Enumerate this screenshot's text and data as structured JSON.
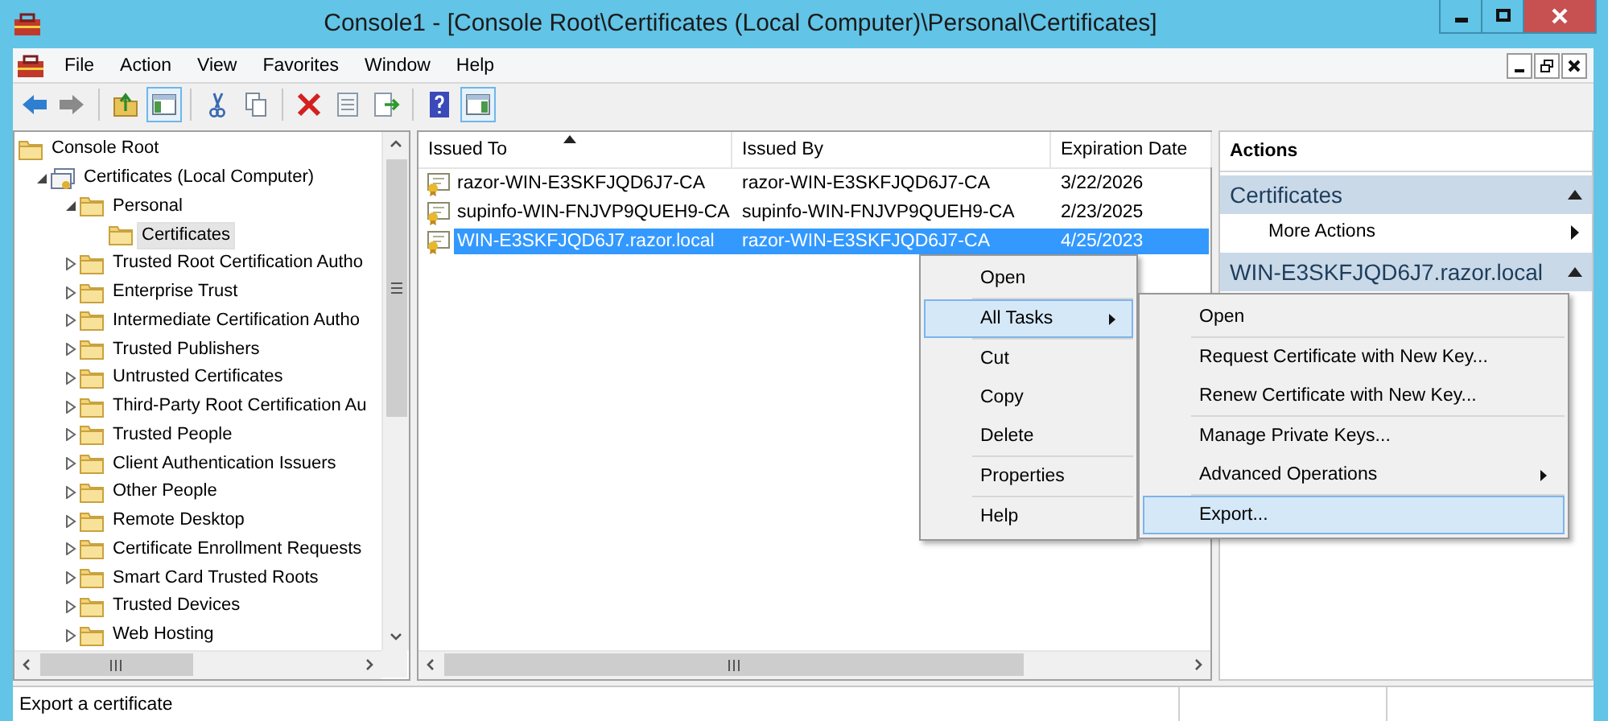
{
  "window": {
    "title": "Console1 - [Console Root\\Certificates (Local Computer)\\Personal\\Certificates]"
  },
  "menu_bar": [
    "File",
    "Action",
    "View",
    "Favorites",
    "Window",
    "Help"
  ],
  "tree": [
    {
      "label": "Console Root",
      "kind": "folder",
      "expandable": false,
      "selected": false,
      "children": [
        {
          "label": "Certificates (Local Computer)",
          "kind": "store",
          "expandable": true,
          "expanded": true,
          "selected": false,
          "children": [
            {
              "label": "Personal",
              "kind": "folder",
              "expandable": true,
              "expanded": true,
              "selected": false,
              "children": [
                {
                  "label": "Certificates",
                  "kind": "folder",
                  "expandable": false,
                  "selected": true
                }
              ]
            },
            {
              "label": "Trusted Root Certification Autho",
              "kind": "folder",
              "expandable": true,
              "expanded": false,
              "selected": false
            },
            {
              "label": "Enterprise Trust",
              "kind": "folder",
              "expandable": true,
              "expanded": false,
              "selected": false
            },
            {
              "label": "Intermediate Certification Autho",
              "kind": "folder",
              "expandable": true,
              "expanded": false,
              "selected": false
            },
            {
              "label": "Trusted Publishers",
              "kind": "folder",
              "expandable": true,
              "expanded": false,
              "selected": false
            },
            {
              "label": "Untrusted Certificates",
              "kind": "folder",
              "expandable": true,
              "expanded": false,
              "selected": false
            },
            {
              "label": "Third-Party Root Certification Au",
              "kind": "folder",
              "expandable": true,
              "expanded": false,
              "selected": false
            },
            {
              "label": "Trusted People",
              "kind": "folder",
              "expandable": true,
              "expanded": false,
              "selected": false
            },
            {
              "label": "Client Authentication Issuers",
              "kind": "folder",
              "expandable": true,
              "expanded": false,
              "selected": false
            },
            {
              "label": "Other People",
              "kind": "folder",
              "expandable": true,
              "expanded": false,
              "selected": false
            },
            {
              "label": "Remote Desktop",
              "kind": "folder",
              "expandable": true,
              "expanded": false,
              "selected": false
            },
            {
              "label": "Certificate Enrollment Requests",
              "kind": "folder",
              "expandable": true,
              "expanded": false,
              "selected": false
            },
            {
              "label": "Smart Card Trusted Roots",
              "kind": "folder",
              "expandable": true,
              "expanded": false,
              "selected": false
            },
            {
              "label": "Trusted Devices",
              "kind": "folder",
              "expandable": true,
              "expanded": false,
              "selected": false
            },
            {
              "label": "Web Hosting",
              "kind": "folder",
              "expandable": true,
              "expanded": false,
              "selected": false
            }
          ]
        }
      ]
    }
  ],
  "table": {
    "columns": [
      {
        "label": "Issued To",
        "sorted": true
      },
      {
        "label": "Issued By",
        "sorted": false
      },
      {
        "label": "Expiration Date",
        "sorted": false
      }
    ],
    "rows": [
      {
        "selected": false,
        "cells": [
          "razor-WIN-E3SKFJQD6J7-CA",
          "razor-WIN-E3SKFJQD6J7-CA",
          "3/22/2026"
        ]
      },
      {
        "selected": false,
        "cells": [
          "supinfo-WIN-FNJVP9QUEH9-CA",
          "supinfo-WIN-FNJVP9QUEH9-CA",
          "2/23/2025"
        ]
      },
      {
        "selected": true,
        "cells": [
          "WIN-E3SKFJQD6J7.razor.local",
          "razor-WIN-E3SKFJQD6J7-CA",
          "4/25/2023"
        ]
      }
    ]
  },
  "actions": {
    "title": "Actions",
    "sections": [
      {
        "title": "Certificates",
        "expanded": true,
        "items": [
          {
            "label": "More Actions",
            "submenu": true
          }
        ]
      },
      {
        "title": "WIN-E3SKFJQD6J7.razor.local",
        "expanded": true
      }
    ]
  },
  "context_menu": {
    "groups": [
      [
        {
          "label": "Open",
          "highlighted": false,
          "submenu": false
        }
      ],
      [
        {
          "label": "All Tasks",
          "highlighted": true,
          "submenu": true
        }
      ],
      [
        {
          "label": "Cut",
          "highlighted": false,
          "submenu": false
        },
        {
          "label": "Copy",
          "highlighted": false,
          "submenu": false
        },
        {
          "label": "Delete",
          "highlighted": false,
          "submenu": false
        }
      ],
      [
        {
          "label": "Properties",
          "highlighted": false,
          "submenu": false
        }
      ],
      [
        {
          "label": "Help",
          "highlighted": false,
          "submenu": false
        }
      ]
    ]
  },
  "submenu": {
    "groups": [
      [
        {
          "label": "Open",
          "highlighted": false,
          "submenu": false
        }
      ],
      [
        {
          "label": "Request Certificate with New Key...",
          "highlighted": false,
          "submenu": false
        },
        {
          "label": "Renew Certificate with New Key...",
          "highlighted": false,
          "submenu": false
        }
      ],
      [
        {
          "label": "Manage Private Keys...",
          "highlighted": false,
          "submenu": false
        },
        {
          "label": "Advanced Operations",
          "highlighted": false,
          "submenu": true
        }
      ],
      [
        {
          "label": "Export...",
          "highlighted": true,
          "submenu": false
        }
      ]
    ]
  },
  "status_bar": {
    "text": "Export a certificate"
  }
}
